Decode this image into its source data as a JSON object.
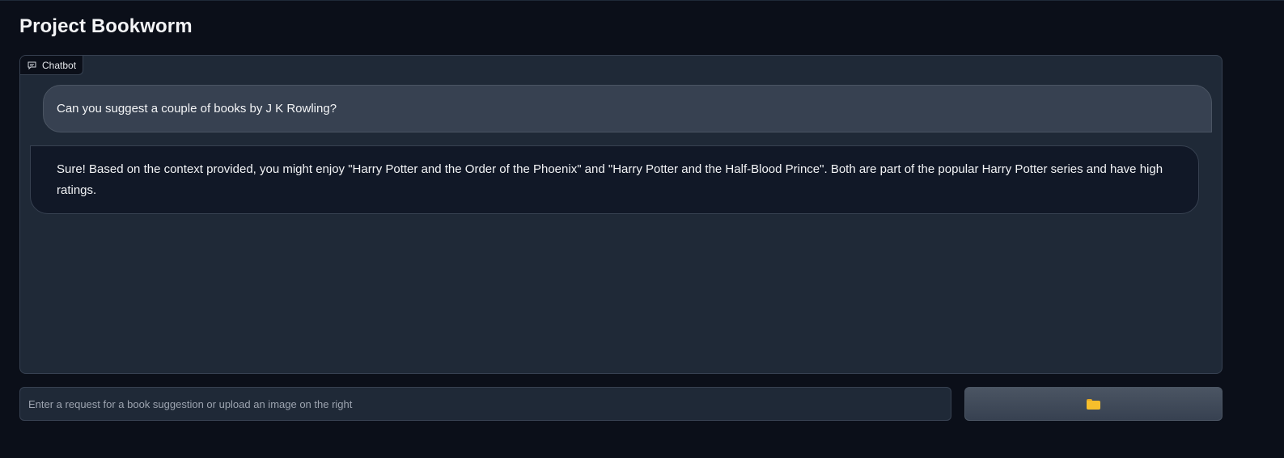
{
  "app": {
    "title": "Project Bookworm"
  },
  "chatbot": {
    "label": "Chatbot",
    "label_icon": "chat-bubble-icon",
    "messages": [
      {
        "role": "user",
        "text": "Can you suggest a couple of books by J K Rowling?"
      },
      {
        "role": "bot",
        "text": "Sure! Based on the context provided, you might enjoy \"Harry Potter and the Order of the Phoenix\" and \"Harry Potter and the Half-Blood Prince\". Both are part of the popular Harry Potter series and have high ratings."
      }
    ]
  },
  "input": {
    "value": "",
    "placeholder": "Enter a request for a book suggestion or upload an image on the right"
  },
  "upload_button": {
    "icon": "folder-icon"
  },
  "colors": {
    "background": "#0b0f19",
    "panel": "#1f2937",
    "user_bubble": "#374151",
    "bot_bubble": "#111827",
    "border": "#374151",
    "text": "#f3f4f6",
    "placeholder": "#9ca3af",
    "folder": "#f6be2c"
  }
}
